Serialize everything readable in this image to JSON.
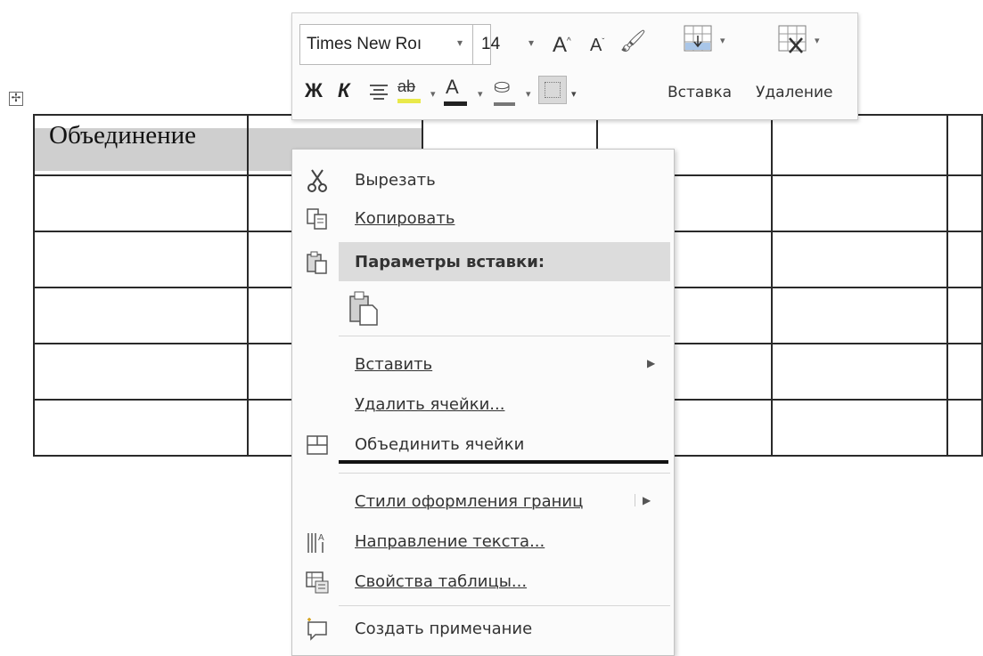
{
  "document": {
    "table_handle_icon": "move-cross-icon",
    "merged_cell_text": "Объединение",
    "columns": 6,
    "rows": 6
  },
  "mini_toolbar": {
    "font_name": "Times New Roı",
    "font_size": "14",
    "grow_font_label": "A",
    "shrink_font_label": "A",
    "bold_label": "Ж",
    "italic_label": "К",
    "highlight_label": "ab",
    "font_color_label": "A",
    "highlight_color": "#e9e94a",
    "font_color": "#222222",
    "insert_label": "Вставка",
    "delete_label": "Удаление"
  },
  "context_menu": {
    "items": [
      {
        "label": "Вырезать",
        "icon": "scissors-icon"
      },
      {
        "label": "Копировать",
        "icon": "copy-icon"
      },
      {
        "label": "Параметры вставки:",
        "icon": "paste-icon"
      },
      {
        "label": "",
        "icon": "paste-keep-source-icon"
      },
      {
        "label": "Вставить",
        "icon": "",
        "submenu": true
      },
      {
        "label": "Удалить ячейки...",
        "icon": ""
      },
      {
        "label": "Объединить ячейки",
        "icon": "merge-cells-icon"
      },
      {
        "label": "Стили оформления границ",
        "icon": "",
        "submenu": true
      },
      {
        "label": "Направление текста...",
        "icon": "text-direction-icon"
      },
      {
        "label": "Свойства таблицы...",
        "icon": "table-properties-icon"
      },
      {
        "label": "Создать примечание",
        "icon": "new-comment-icon"
      }
    ]
  }
}
